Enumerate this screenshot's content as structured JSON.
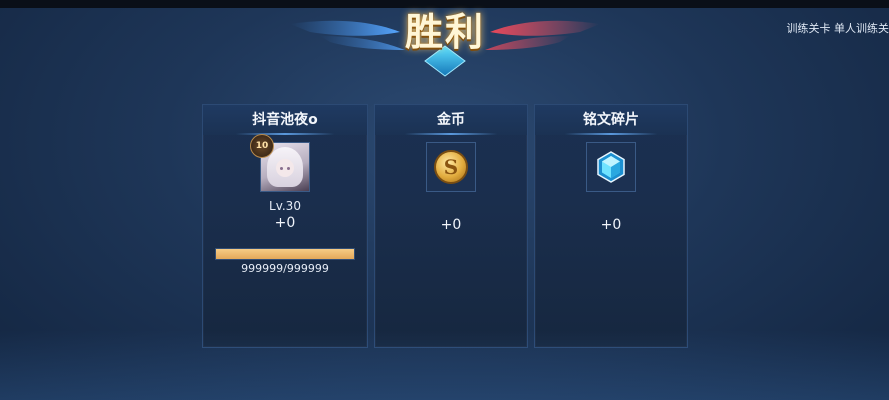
{
  "header": {
    "victory_title": "胜利",
    "mode_label": "训练关卡 单人训练关"
  },
  "cards": {
    "player": {
      "name": "抖音池夜o",
      "rank_badge": "10",
      "level": "Lv.30",
      "gain": "+0",
      "exp_text": "999999/999999",
      "exp_fraction": 1.0
    },
    "gold": {
      "title": "金币",
      "icon": "gold-coin-icon",
      "gain": "+0"
    },
    "inscription": {
      "title": "铭文碎片",
      "icon": "crystal-gem-icon",
      "gain": "+0"
    }
  },
  "colors": {
    "background": "#1e3658",
    "card": "#1a2e4d",
    "exp_bar": "#f0bf78",
    "accent_blue": "#5a98dc"
  }
}
